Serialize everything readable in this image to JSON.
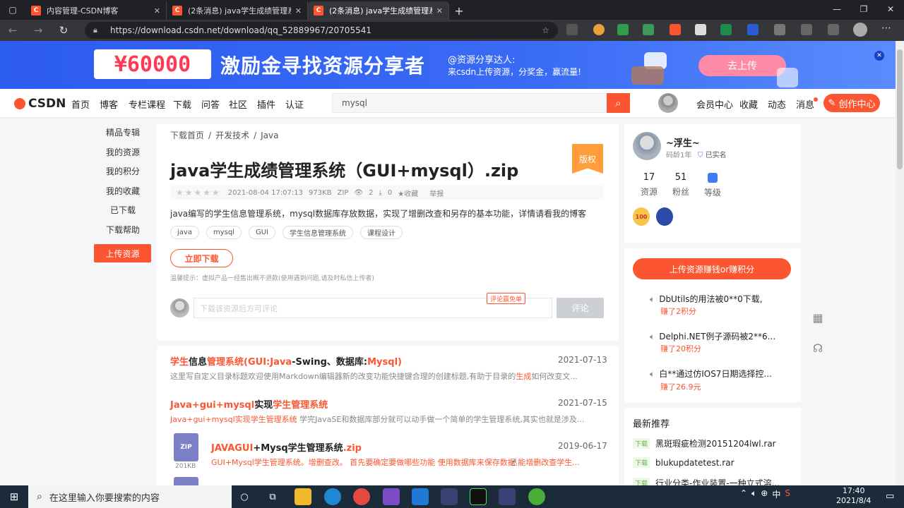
{
  "browser": {
    "tabs": [
      {
        "favicon": "C",
        "title": "内容管理-CSDN博客"
      },
      {
        "favicon": "C",
        "title": "(2条消息) java学生成绩管理系统"
      },
      {
        "favicon": "C",
        "title": "(2条消息) java学生成绩管理系统"
      }
    ],
    "url": "https://download.csdn.net/download/qq_52889967/20705541"
  },
  "banner": {
    "amount": "¥60000",
    "slogan": "激励金寻找资源分享者",
    "who": "@资源分享达人:",
    "sub": "来csdn上传资源，分奖金，赢流量!",
    "upload": "去上传"
  },
  "topnav": {
    "logo": "CSDN",
    "items": [
      "首页",
      "博客",
      "专栏课程",
      "下载",
      "问答",
      "社区",
      "插件",
      "认证"
    ],
    "search_value": "mysql",
    "right": [
      "会员中心",
      "收藏",
      "动态",
      "消息"
    ],
    "create": "创作中心"
  },
  "leftmenu": {
    "items": [
      "精品专辑",
      "我的资源",
      "我的积分",
      "我的收藏",
      "已下载",
      "下载帮助"
    ],
    "upload": "上传资源"
  },
  "resource": {
    "breadcrumb": [
      "下载首页",
      "开发技术",
      "Java"
    ],
    "title": "java学生成绩管理系统（GUI+mysql）.zip",
    "badge": "版权",
    "date": "2021-08-04 17:07:13",
    "size": "973KB",
    "type": "ZIP",
    "views": "2",
    "downloads": "0",
    "collect": "收藏",
    "report": "举报",
    "description": "java编写的学生信息管理系统，mysql数据库存放数据，实现了增删改查和另存的基本功能，详情请看我的博客",
    "tags": [
      "java",
      "mysql",
      "GUI",
      "学生信息管理系统",
      "课程设计"
    ],
    "download_btn": "立即下载",
    "notice": "温馨提示：虚拟产品一经售出概不退款(使用遇到问题,请及时私信上传者)",
    "comment_placeholder": "下载该资源后方可评论",
    "comment_tip": "评论赢免单",
    "comment_btn": "评论"
  },
  "related": [
    {
      "t_parts": [
        "学生",
        "信息",
        "管理系统",
        "(GUI:",
        "Java",
        "-Swing、数据库:",
        "Mysql",
        ")"
      ],
      "date": "2021-07-13",
      "d_pre": "这里写自定义目录标题欢迎使用Markdown编辑器新的改变功能快捷键合理的创建标题,有助于目录的",
      "d_hl": "生成",
      "d_post": "如何改变文..."
    },
    {
      "t_parts": [
        "Java+gui+mysql",
        "实现",
        "学生管理系统"
      ],
      "date": "2021-07-15",
      "d_pre": "Java+gui+mysql实现",
      "d_hl": "学生管理系统",
      "d_post": " 学完JavaSE和数据库部分就可以动手做一个简单的学生管理系统,其实也就是涉及..."
    },
    {
      "t_parts": [
        "JAVAGUI",
        "+Mysq学生管理系统",
        ".zip"
      ],
      "date": "2019-06-17",
      "d_pre": "GUI+Mysql学生管理系统。增删查改。 首先要确定要做哪些功能 使用数据库来保存数据 能增删改查学生...",
      "d_hl": "",
      "d_post": "",
      "file_type": "ZIP",
      "file_size": "201KB"
    }
  ],
  "user": {
    "name": "~浮生~",
    "age": "码龄1年",
    "verified": "已实名",
    "stats": [
      {
        "n": "17",
        "l": "资源"
      },
      {
        "n": "51",
        "l": "粉丝"
      },
      {
        "n": "",
        "l": "等级"
      }
    ],
    "medal1": "100"
  },
  "earn": {
    "button": "上传资源赚钱or赚积分",
    "items": [
      {
        "t": "DbUtils的用法被0**0下载,",
        "p": "赚了2积分"
      },
      {
        "t": "Delphi.NET例子源码被2**6...",
        "p": "赚了20积分"
      },
      {
        "t": "白**通过仿IOS7日期选择控...",
        "p": "赚了26.9元"
      }
    ]
  },
  "recommend": {
    "title": "最新推荐",
    "tag": "下载",
    "items": [
      "黑斑瑕疵检测20151204lwl.rar",
      "blukupdatetest.rar",
      "行业分类-作业装置-一种立式溶..."
    ]
  },
  "taskbar": {
    "search": "在这里输入你要搜索的内容",
    "ime": "中",
    "time": "17:40",
    "date": "2021/8/4"
  },
  "colors": {
    "accent": "#fc5531",
    "banner": "#2d5cf0"
  }
}
